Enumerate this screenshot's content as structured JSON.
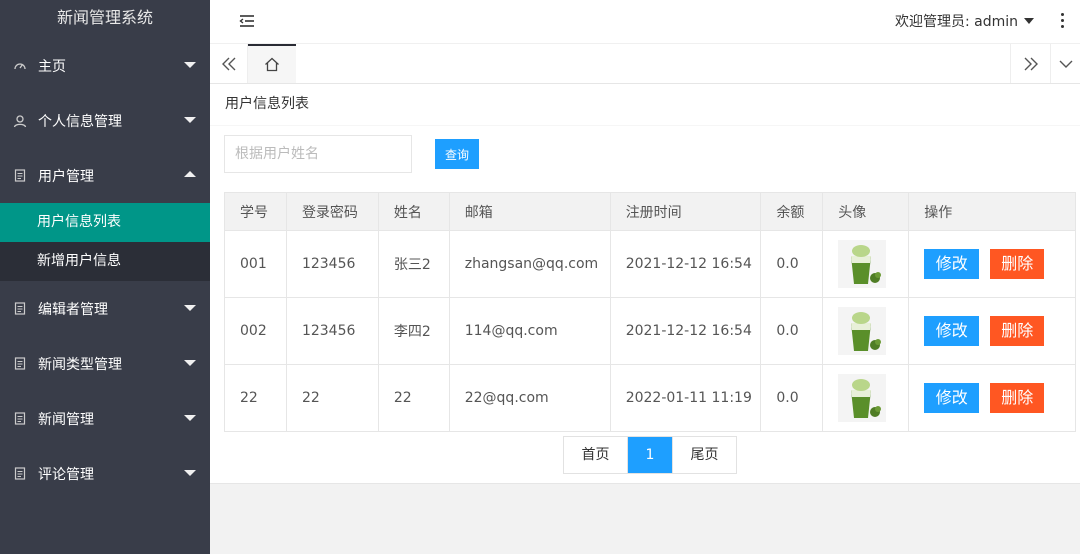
{
  "app": {
    "title": "新闻管理系统"
  },
  "sidebar": {
    "items": [
      {
        "label": "主页",
        "icon": "gauge-icon",
        "expanded": false
      },
      {
        "label": "个人信息管理",
        "icon": "user-icon",
        "expanded": false
      },
      {
        "label": "用户管理",
        "icon": "doc-icon",
        "expanded": true,
        "children": [
          {
            "label": "用户信息列表",
            "active": true
          },
          {
            "label": "新增用户信息",
            "active": false
          }
        ]
      },
      {
        "label": "编辑者管理",
        "icon": "doc-icon",
        "expanded": false
      },
      {
        "label": "新闻类型管理",
        "icon": "doc-icon",
        "expanded": false
      },
      {
        "label": "新闻管理",
        "icon": "doc-icon",
        "expanded": false
      },
      {
        "label": "评论管理",
        "icon": "doc-icon",
        "expanded": false
      }
    ]
  },
  "header": {
    "welcome": "欢迎管理员: admin"
  },
  "main": {
    "card_title": "用户信息列表",
    "search": {
      "placeholder": "根据用户姓名",
      "value": "",
      "button": "查询"
    },
    "table": {
      "columns": [
        "学号",
        "登录密码",
        "姓名",
        "邮箱",
        "注册时间",
        "余额",
        "头像",
        "操作"
      ],
      "rows": [
        {
          "id": "001",
          "password": "123456",
          "name": "张三2",
          "email": "zhangsan@qq.com",
          "registered": "2021-12-12 16:54",
          "balance": "0.0"
        },
        {
          "id": "002",
          "password": "123456",
          "name": "李四2",
          "email": "114@qq.com",
          "registered": "2021-12-12 16:54",
          "balance": "0.0"
        },
        {
          "id": "22",
          "password": "22",
          "name": "22",
          "email": "22@qq.com",
          "registered": "2022-01-11 11:19",
          "balance": "0.0"
        }
      ],
      "edit_label": "修改",
      "delete_label": "删除"
    },
    "pager": {
      "first": "首页",
      "current": "1",
      "last": "尾页"
    }
  },
  "colors": {
    "sidebar_bg": "#393d49",
    "active_item": "#009688",
    "primary": "#1e9fff",
    "danger": "#ff5722"
  }
}
